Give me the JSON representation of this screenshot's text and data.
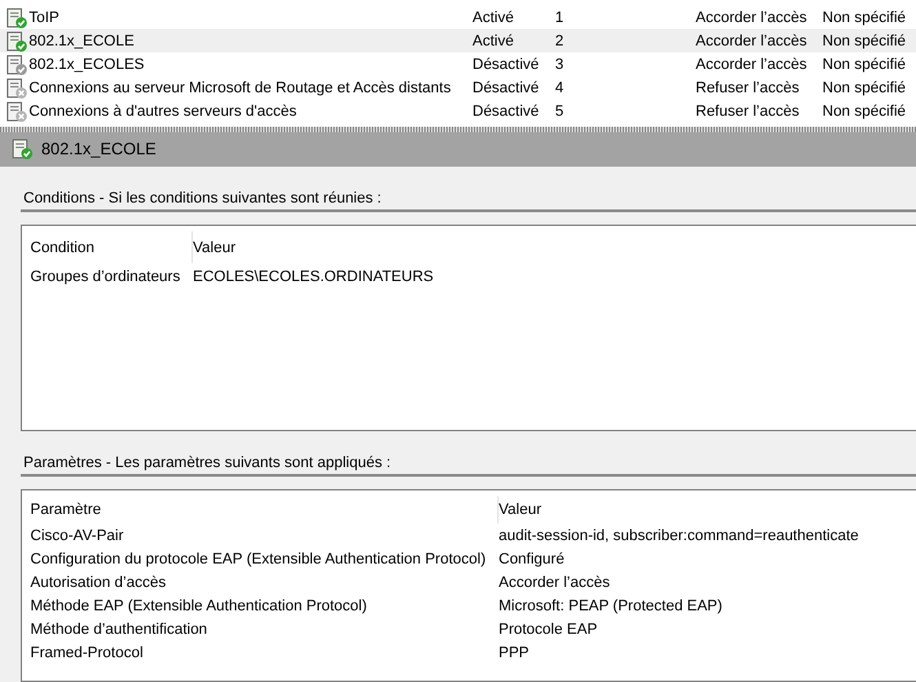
{
  "policies": [
    {
      "name": "ToIP",
      "status": "Activé",
      "order": "1",
      "access": "Accorder l’accès",
      "type": "Non spécifié",
      "kind": "allow",
      "enabled": true,
      "selected": false
    },
    {
      "name": "802.1x_ECOLE",
      "status": "Activé",
      "order": "2",
      "access": "Accorder l’accès",
      "type": "Non spécifié",
      "kind": "allow",
      "enabled": true,
      "selected": true
    },
    {
      "name": "802.1x_ECOLES",
      "status": "Désactivé",
      "order": "3",
      "access": "Accorder l’accès",
      "type": "Non spécifié",
      "kind": "allow",
      "enabled": false,
      "selected": false
    },
    {
      "name": "Connexions au serveur Microsoft de Routage et Accès distants",
      "status": "Désactivé",
      "order": "4",
      "access": "Refuser l’accès",
      "type": "Non spécifié",
      "kind": "deny",
      "enabled": false,
      "selected": false
    },
    {
      "name": "Connexions à d'autres serveurs d'accès",
      "status": "Désactivé",
      "order": "5",
      "access": "Refuser l’accès",
      "type": "Non spécifié",
      "kind": "deny",
      "enabled": false,
      "selected": false
    }
  ],
  "detail": {
    "title": "802.1x_ECOLE",
    "conditions": {
      "heading": "Conditions - Si les conditions suivantes sont réunies :",
      "columns": [
        "Condition",
        "Valeur"
      ],
      "rows": [
        [
          "Groupes d’ordinateurs",
          "ECOLES\\ECOLES.ORDINATEURS"
        ]
      ]
    },
    "settings": {
      "heading": "Paramètres - Les paramètres suivants sont appliqués :",
      "columns": [
        "Paramètre",
        "Valeur"
      ],
      "rows": [
        [
          "Cisco-AV-Pair",
          "audit-session-id, subscriber:command=reauthenticate"
        ],
        [
          "Configuration du protocole EAP (Extensible Authentication Protocol)",
          "Configuré"
        ],
        [
          "Autorisation d’accès",
          "Accorder l’accès"
        ],
        [
          "Méthode EAP (Extensible Authentication Protocol)",
          "Microsoft: PEAP (Protected EAP)"
        ],
        [
          "Méthode d’authentification",
          "Protocole EAP"
        ],
        [
          "Framed-Protocol",
          "PPP"
        ]
      ]
    }
  }
}
